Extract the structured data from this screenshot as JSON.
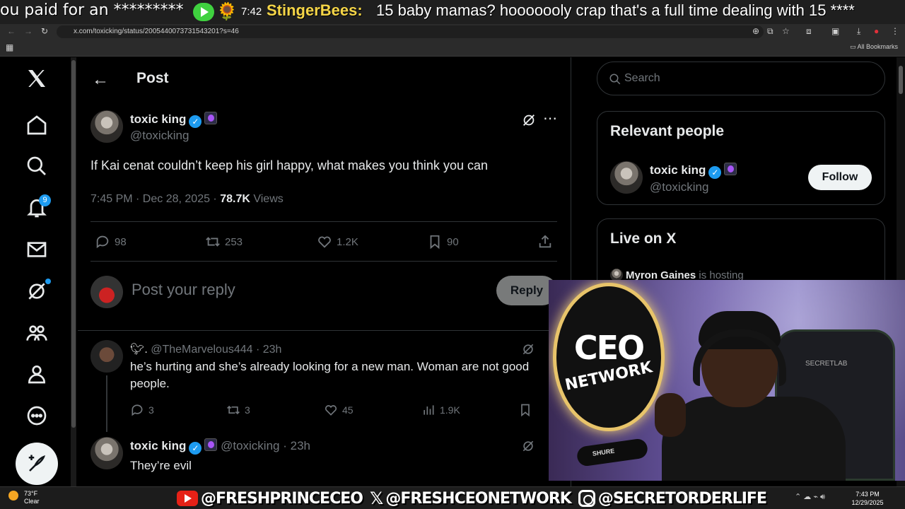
{
  "stream": {
    "ticker": "ou paid for an *********",
    "time": "7:42",
    "chat_user": "StingerBees:",
    "chat_message": "15 baby mamas? hooooooly crap that's a full time dealing with 15 ****"
  },
  "browser": {
    "url": "x.com/toxicking/status/2005440073731543201?s=46",
    "all_bookmarks": "All Bookmarks"
  },
  "nav": {
    "notifications_badge": "9"
  },
  "post": {
    "header_title": "Post",
    "author_name": "toxic king",
    "author_handle": "@toxicking",
    "text": "If Kai cenat couldn’t keep his girl happy, what makes you think you can",
    "timestamp": "7:45 PM · Dec 28, 2025 · ",
    "views_count": "78.7K",
    "views_label": " Views",
    "replies": "98",
    "reposts": "253",
    "likes": "1.2K",
    "bookmarks": "90"
  },
  "reply_box": {
    "placeholder": "Post your reply",
    "button": "Reply"
  },
  "replies": [
    {
      "handle": "@TheMarvelous444",
      "age": "· 23h",
      "text": "he’s hurting and she’s already looking for a new man. Woman are not good people.",
      "replies": "3",
      "reposts": "3",
      "likes": "45",
      "views": "1.9K"
    },
    {
      "name": "toxic king",
      "handle": "@toxicking",
      "age": "· 23h",
      "text": "They’re evil"
    }
  ],
  "sidebar": {
    "search_placeholder": "Search",
    "relevant_title": "Relevant people",
    "person_name": "toxic king",
    "person_handle": "@toxicking",
    "follow_label": "Follow",
    "live_title": "Live on X",
    "host_name": "Myron Gaines",
    "host_suffix": " is hosting"
  },
  "webcam": {
    "logo_top": "CEO",
    "logo_bottom": "NETWORK",
    "mic_brand": "SHURE",
    "chair_brand": "SECRETLAB"
  },
  "banner": {
    "youtube": "@FRESHPRINCECEO",
    "x": "@FRESHCEONETWORK",
    "instagram": "@SECRETORDERLIFE"
  },
  "taskbar": {
    "temp": "73°F",
    "weather": "Clear",
    "time": "7:43 PM",
    "date": "12/29/2025"
  },
  "colors": {
    "accent": "#1d9bf0",
    "background": "#000000",
    "text": "#e7e9ea",
    "muted": "#71767b"
  }
}
